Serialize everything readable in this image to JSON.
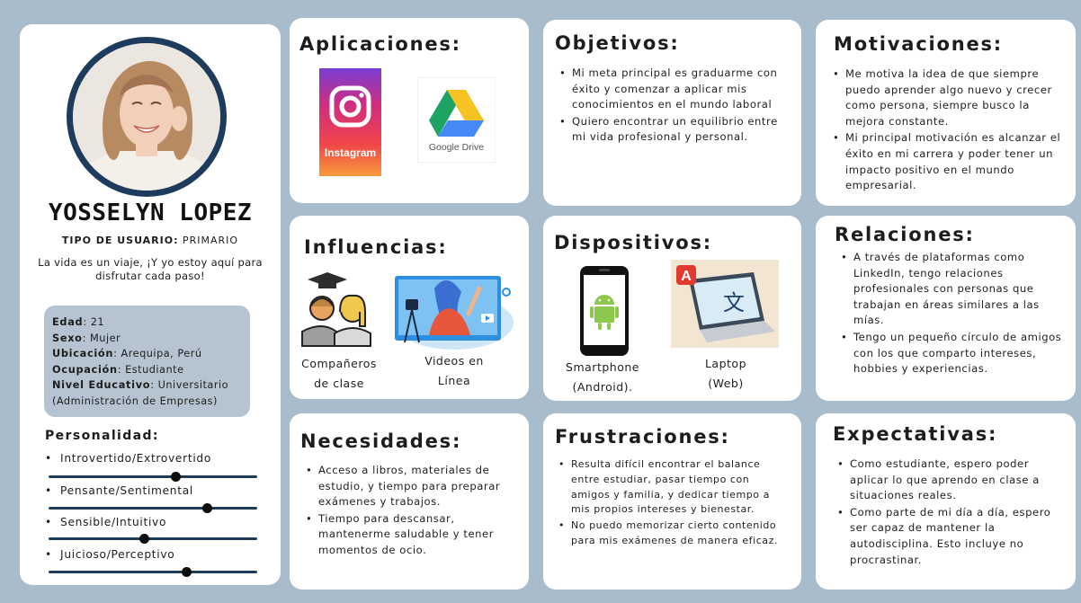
{
  "profile": {
    "name": "YOSSELYN LOPEZ",
    "user_type_label": "TIPO DE USUARIO:",
    "user_type_value": " PRIMARIO",
    "quote": "La vida es un viaje, ¡Y yo estoy aquí para disfrutar cada paso!",
    "details": [
      {
        "label": "Edad",
        "value": ": 21"
      },
      {
        "label": "Sexo",
        "value": ": Mujer"
      },
      {
        "label": "Ubicación",
        "value": ": Arequipa, Perú"
      },
      {
        "label": "Ocupación",
        "value": ": Estudiante"
      },
      {
        "label": "Nivel Educativo",
        "value": ": Universitario (Administración de Empresas)"
      }
    ],
    "personality_title": "Personalidad:",
    "traits": [
      {
        "label": "Introvertido/Extrovertido",
        "level": 0.61
      },
      {
        "label": "Pensante/Sentimental",
        "level": 0.76
      },
      {
        "label": "Sensible/Intuitivo",
        "level": 0.46
      },
      {
        "label": "Juicioso/Perceptivo",
        "level": 0.66
      }
    ]
  },
  "aplicaciones": {
    "title": "Aplicaciones:",
    "apps": [
      {
        "name": "Instagram",
        "icon": "instagram-icon"
      },
      {
        "name": "Google Drive",
        "icon": "google-drive-icon"
      }
    ]
  },
  "objetivos": {
    "title": "Objetivos:",
    "items": [
      "Mi meta principal es graduarme con éxito y comenzar a aplicar mis conocimientos en el mundo laboral",
      "Quiero encontrar un equilibrio entre mi vida profesional y personal."
    ]
  },
  "motivaciones": {
    "title": "Motivaciones:",
    "items": [
      "Me motiva la idea de que siempre puedo aprender algo nuevo y crecer como persona, siempre busco la mejora constante.",
      "Mi principal motivación es alcanzar el éxito en mi carrera y poder tener un impacto positivo en el mundo empresarial."
    ]
  },
  "influencias": {
    "title": "Influencias:",
    "items": [
      {
        "caption": "Compañeros de clase",
        "icon": "classmates-icon"
      },
      {
        "caption": "Videos en Línea",
        "icon": "online-video-icon"
      }
    ]
  },
  "dispositivos": {
    "title": "Dispositivos:",
    "items": [
      {
        "caption": "Smartphone (Android).",
        "icon": "android-phone-icon"
      },
      {
        "caption": "Laptop (Web)",
        "icon": "laptop-translate-icon"
      }
    ]
  },
  "relaciones": {
    "title": "Relaciones:",
    "items": [
      "A través de plataformas como LinkedIn, tengo relaciones profesionales con personas que trabajan en áreas similares a las mías.",
      "Tengo un pequeño círculo de amigos con los que comparto intereses, hobbies y experiencias."
    ]
  },
  "necesidades": {
    "title": "Necesidades:",
    "items": [
      "Acceso a libros, materiales de estudio, y tiempo para preparar exámenes y trabajos.",
      "Tiempo para descansar, mantenerme saludable y tener momentos de ocio."
    ]
  },
  "frustraciones": {
    "title": "Frustraciones:",
    "items": [
      "Resulta difícil encontrar el balance entre estudiar, pasar tiempo con amigos y familia, y dedicar tiempo a mis propios intereses y bienestar.",
      "No puedo memorizar cierto contenido para mis exámenes de manera eficaz."
    ]
  },
  "expectativas": {
    "title": "Expectativas:",
    "items": [
      "Como estudiante, espero poder aplicar lo que aprendo en clase a situaciones reales.",
      "Como parte de mi día a día, espero ser capaz de mantener la autodisciplina. Esto incluye no procrastinar."
    ]
  },
  "colors": {
    "background": "#a9bccc",
    "accent_navy": "#1d3b5c",
    "info_box": "#b6c4d2",
    "card": "#ffffff"
  }
}
